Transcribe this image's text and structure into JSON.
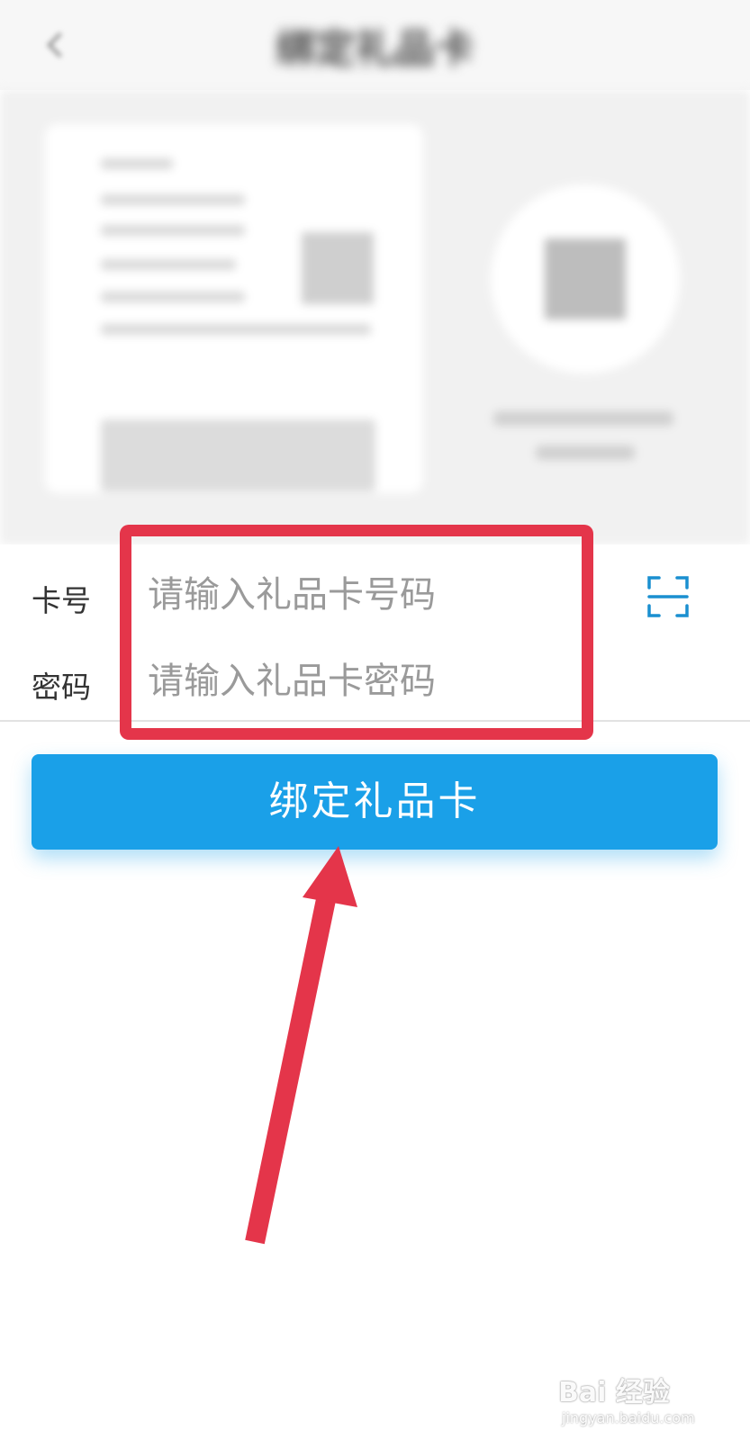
{
  "header": {
    "title": "绑定礼品卡"
  },
  "form": {
    "card_number": {
      "label": "卡号",
      "placeholder": "请输入礼品卡号码"
    },
    "password": {
      "label": "密码",
      "placeholder": "请输入礼品卡密码"
    }
  },
  "actions": {
    "bind_label": "绑定礼品卡"
  },
  "annotation": {
    "color": "#e4354a"
  },
  "theme": {
    "primary": "#1aa0e8",
    "scan_icon_color": "#1a8fd0"
  },
  "icons": {
    "back": "chevron-left-icon",
    "scan": "scan-icon"
  },
  "watermark": {
    "brand": "Bai 经验",
    "sub": "jingyan.baidu.com"
  }
}
